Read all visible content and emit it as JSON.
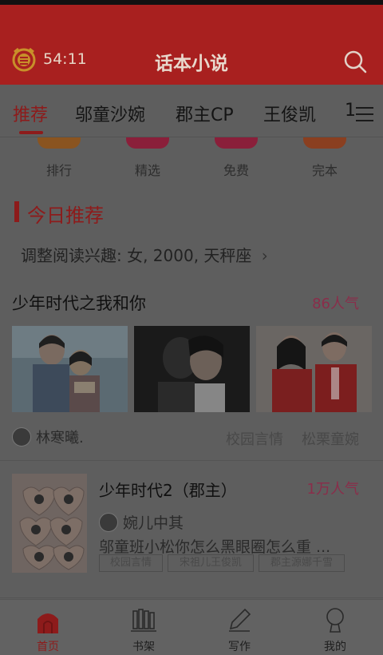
{
  "header": {
    "timer": "54:11",
    "title": "话本小说"
  },
  "tabs": [
    {
      "label": "推荐",
      "active": true
    },
    {
      "label": "邬童沙婉",
      "active": false
    },
    {
      "label": "郡主CP",
      "active": false
    },
    {
      "label": "王俊凯",
      "active": false
    },
    {
      "label": "1",
      "active": false
    }
  ],
  "categories": [
    {
      "label": "排行",
      "color": "#8a5420"
    },
    {
      "label": "精选",
      "color": "#8a1f3a"
    },
    {
      "label": "免费",
      "color": "#8a1f3a"
    },
    {
      "label": "完本",
      "color": "#8a3f20"
    }
  ],
  "today": {
    "title": "今日推荐",
    "interest": "调整阅读兴趣: 女, 2000, 天秤座",
    "chevron": "›"
  },
  "book1": {
    "title": "少年时代之我和你",
    "popularity": "86人气",
    "author": "林寒曦.",
    "tags": [
      "校园言情",
      "松栗童婉"
    ]
  },
  "book2": {
    "title": "少年时代2（郡主）",
    "popularity": "1万人气",
    "author": "婉儿中其",
    "description": "邬童班小松你怎么黑眼圈怎么重 ...",
    "chips": [
      "校园言情",
      "宋祖儿王俊凯",
      "郡主源娜千雪"
    ]
  },
  "bottom_nav": [
    {
      "label": "首页",
      "icon": "home-icon",
      "active": true
    },
    {
      "label": "书架",
      "icon": "bookshelf-icon",
      "active": false
    },
    {
      "label": "写作",
      "icon": "pen-icon",
      "active": false
    },
    {
      "label": "我的",
      "icon": "profile-icon",
      "active": false
    }
  ],
  "colors": {
    "accent": "#8d1b1b",
    "header": "#a8201f",
    "popularity": "#8a2d4a"
  }
}
